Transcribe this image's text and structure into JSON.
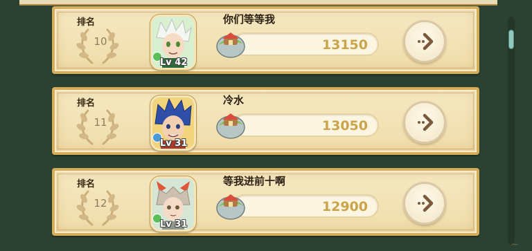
{
  "leaderboard": {
    "rank_label": "排名",
    "entries": [
      {
        "rank": "10",
        "name": "你们等等我",
        "level": "Lv 42",
        "score": "13150"
      },
      {
        "rank": "11",
        "name": "冷水",
        "level": "Lv 31",
        "score": "13050"
      },
      {
        "rank": "12",
        "name": "等我进前十啊",
        "level": "Lv 31",
        "score": "12900"
      }
    ]
  },
  "colors": {
    "background": "#2b4232",
    "card": "#f3e3b6",
    "card_border": "#d6ae5a",
    "score_text": "#c9a44a",
    "arrow": "#7a5a3a"
  },
  "icons": [
    "laurel-icon",
    "island-icon",
    "arrow-right-icon",
    "avatar-portrait"
  ]
}
